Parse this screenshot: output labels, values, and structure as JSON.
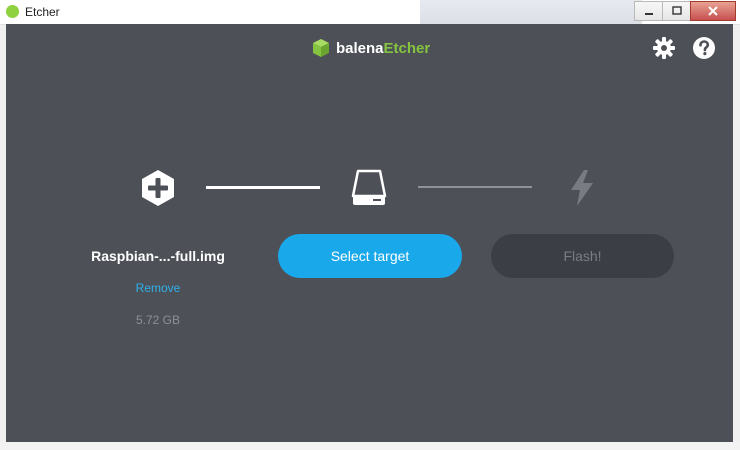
{
  "window": {
    "title": "Etcher",
    "controls": {
      "minimize": "minimize-icon",
      "maximize": "maximize-icon",
      "close": "close-icon"
    }
  },
  "header": {
    "logo_part1": "balena",
    "logo_part2": "Etcher",
    "settings_icon": "gear-icon",
    "help_icon": "question-icon"
  },
  "steps": {
    "image": {
      "icon": "plus-hexagon-icon",
      "filename": "Raspbian-...-full.img",
      "remove_label": "Remove",
      "size": "5.72 GB"
    },
    "target": {
      "icon": "drive-icon",
      "button_label": "Select target"
    },
    "flash": {
      "icon": "lightning-icon",
      "button_label": "Flash!"
    }
  },
  "colors": {
    "background": "#4d5057",
    "accent_blue": "#19a8ea",
    "brand_green": "#85c440",
    "link_blue": "#2fb2ea",
    "disabled_button": "#3b3e44"
  }
}
